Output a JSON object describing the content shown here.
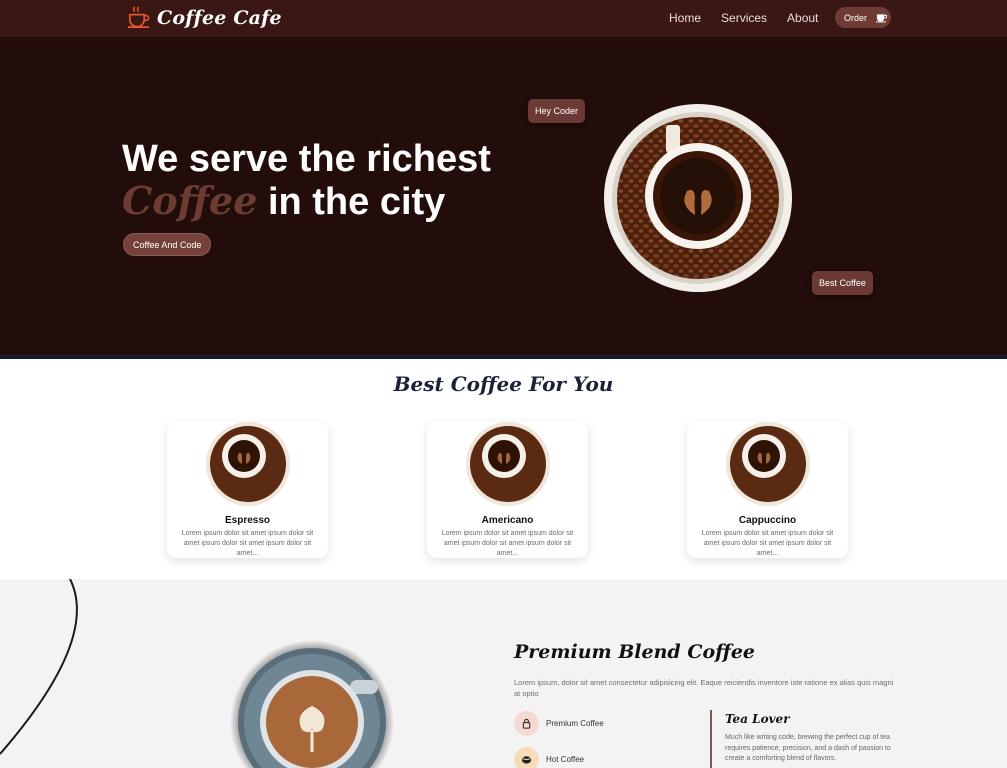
{
  "nav": {
    "brand": "Coffee Cafe",
    "links": [
      "Home",
      "Services",
      "About"
    ],
    "order_label": "Order"
  },
  "hero": {
    "title_line1": "We serve the richest",
    "title_accent": "Coffee",
    "title_line2_rest": "in the city",
    "cta_label": "Coffee And Code",
    "tag_hey": "Hey Coder",
    "tag_best": "Best Coffee"
  },
  "best": {
    "title": "Best Coffee For You",
    "cards": [
      {
        "name": "Espresso",
        "desc": "Lorem ipsum dolor sit amet ipsum dolor sit amet ipsum dolor sit amet ipsum dolor sit amet..."
      },
      {
        "name": "Americano",
        "desc": "Lorem ipsum dolor sit amet ipsum dolor sit amet ipsum dolor sit amet ipsum dolor sit amet..."
      },
      {
        "name": "Cappuccino",
        "desc": "Lorem ipsum dolor sit amet ipsum dolor sit amet ipsum dolor sit amet ipsum dolor sit amet..."
      }
    ]
  },
  "premium": {
    "title": "Premium Blend Coffee",
    "desc": "Lorem ipsum, dolor sit amet consectetur adipisicing elit. Eaque reiciendis inventore iste ratione ex alias quis magni at optio",
    "features": [
      "Premium Coffee",
      "Hot Coffee"
    ],
    "tea_title": "Tea Lover",
    "tea_desc": "Much like writing code, brewing the perfect cup of tea requires patience, precision, and a dash of passion to create a comforting blend of flavors."
  },
  "colors": {
    "nav_bg": "#3a1715",
    "hero_bg": "#220d0a",
    "accent_brown": "#6c3c32",
    "section_bg": "#f3f3f3"
  },
  "icons": [
    "coffee-cup-icon",
    "order-cup-icon",
    "lock-icon",
    "coffee-bean-icon"
  ]
}
